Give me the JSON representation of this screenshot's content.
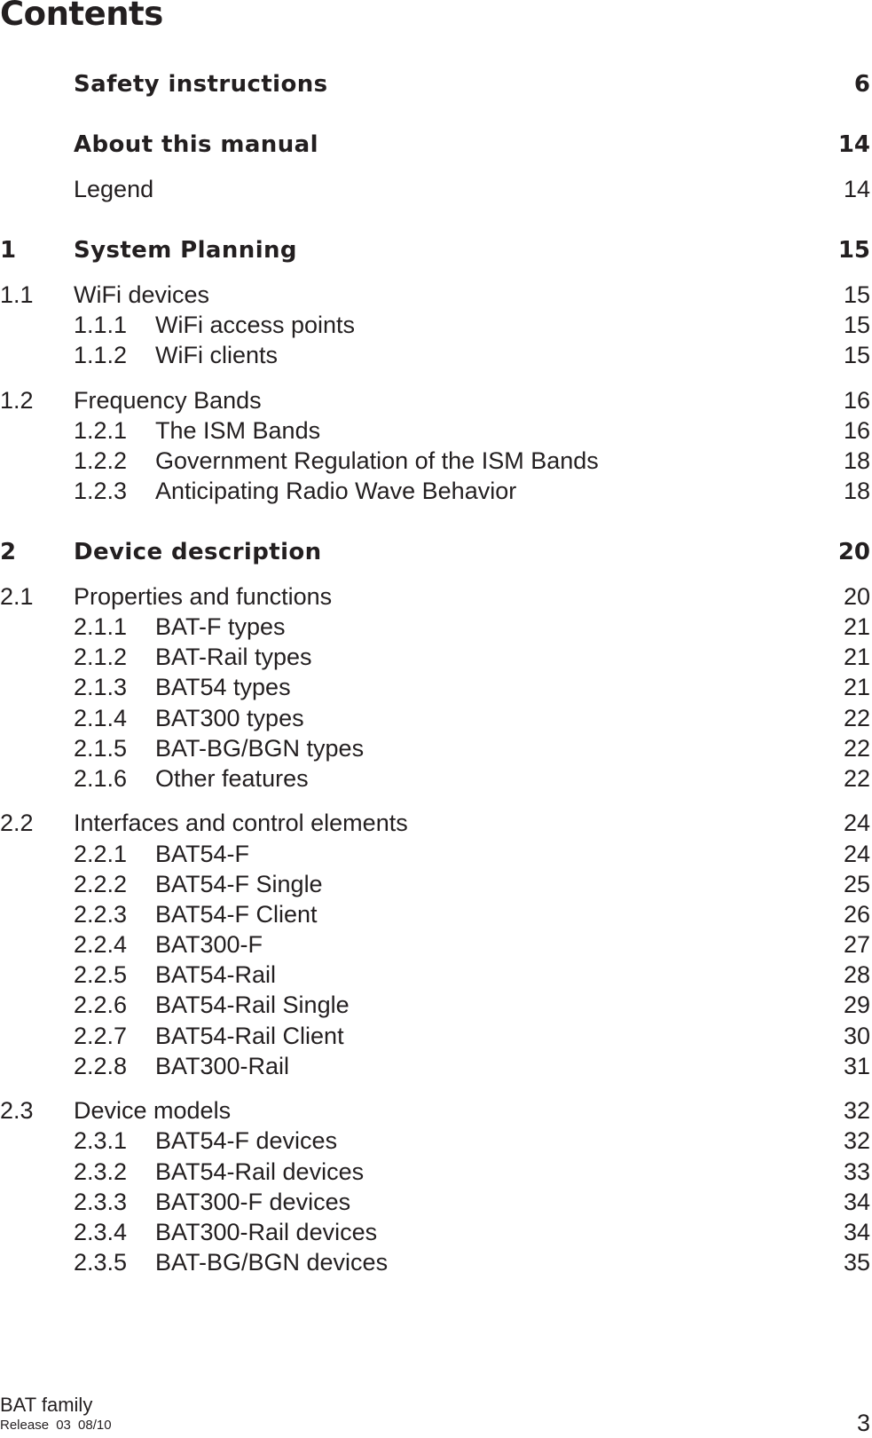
{
  "page_title": "Contents",
  "toc": [
    {
      "number": "",
      "title": "Safety instructions",
      "page": "6",
      "level": 0,
      "bold": true
    },
    {
      "number": "",
      "title": "About this manual",
      "page": "14",
      "level": 0,
      "bold": true
    },
    {
      "number": "",
      "title": "Legend",
      "page": "14",
      "level": 0,
      "bold": false
    },
    {
      "number": "1",
      "title": "System Planning",
      "page": "15",
      "level": 1,
      "bold": true
    },
    {
      "number": "1.1",
      "title": "WiFi devices",
      "page": "15",
      "level": 2,
      "bold": false
    },
    {
      "number": "1.1.1",
      "title": "WiFi access points",
      "page": "15",
      "level": 3,
      "bold": false
    },
    {
      "number": "1.1.2",
      "title": "WiFi clients",
      "page": "15",
      "level": 3,
      "bold": false
    },
    {
      "number": "1.2",
      "title": "Frequency Bands",
      "page": "16",
      "level": 2,
      "bold": false
    },
    {
      "number": "1.2.1",
      "title": "The ISM Bands",
      "page": "16",
      "level": 3,
      "bold": false
    },
    {
      "number": "1.2.2",
      "title": "Government Regulation of the ISM Bands",
      "page": "18",
      "level": 3,
      "bold": false
    },
    {
      "number": "1.2.3",
      "title": "Anticipating Radio Wave Behavior",
      "page": "18",
      "level": 3,
      "bold": false
    },
    {
      "number": "2",
      "title": "Device description",
      "page": "20",
      "level": 1,
      "bold": true
    },
    {
      "number": "2.1",
      "title": "Properties and functions",
      "page": "20",
      "level": 2,
      "bold": false
    },
    {
      "number": "2.1.1",
      "title": "BAT-F types",
      "page": "21",
      "level": 3,
      "bold": false
    },
    {
      "number": "2.1.2",
      "title": "BAT-Rail types",
      "page": "21",
      "level": 3,
      "bold": false
    },
    {
      "number": "2.1.3",
      "title": "BAT54 types",
      "page": "21",
      "level": 3,
      "bold": false
    },
    {
      "number": "2.1.4",
      "title": "BAT300 types",
      "page": "22",
      "level": 3,
      "bold": false
    },
    {
      "number": "2.1.5",
      "title": "BAT-BG/BGN types",
      "page": "22",
      "level": 3,
      "bold": false
    },
    {
      "number": "2.1.6",
      "title": "Other features",
      "page": "22",
      "level": 3,
      "bold": false
    },
    {
      "number": "2.2",
      "title": "Interfaces and control elements",
      "page": "24",
      "level": 2,
      "bold": false
    },
    {
      "number": "2.2.1",
      "title": "BAT54-F",
      "page": "24",
      "level": 3,
      "bold": false
    },
    {
      "number": "2.2.2",
      "title": "BAT54-F Single",
      "page": "25",
      "level": 3,
      "bold": false
    },
    {
      "number": "2.2.3",
      "title": "BAT54-F Client",
      "page": "26",
      "level": 3,
      "bold": false
    },
    {
      "number": "2.2.4",
      "title": "BAT300-F",
      "page": "27",
      "level": 3,
      "bold": false
    },
    {
      "number": "2.2.5",
      "title": "BAT54-Rail",
      "page": "28",
      "level": 3,
      "bold": false
    },
    {
      "number": "2.2.6",
      "title": "BAT54-Rail Single",
      "page": "29",
      "level": 3,
      "bold": false
    },
    {
      "number": "2.2.7",
      "title": "BAT54-Rail Client",
      "page": "30",
      "level": 3,
      "bold": false
    },
    {
      "number": "2.2.8",
      "title": "BAT300-Rail",
      "page": "31",
      "level": 3,
      "bold": false
    },
    {
      "number": "2.3",
      "title": "Device models",
      "page": "32",
      "level": 2,
      "bold": false
    },
    {
      "number": "2.3.1",
      "title": "BAT54-F devices",
      "page": "32",
      "level": 3,
      "bold": false
    },
    {
      "number": "2.3.2",
      "title": "BAT54-Rail devices",
      "page": "33",
      "level": 3,
      "bold": false
    },
    {
      "number": "2.3.3",
      "title": "BAT300-F devices",
      "page": "34",
      "level": 3,
      "bold": false
    },
    {
      "number": "2.3.4",
      "title": "BAT300-Rail devices",
      "page": "34",
      "level": 3,
      "bold": false
    },
    {
      "number": "2.3.5",
      "title": "BAT-BG/BGN devices",
      "page": "35",
      "level": 3,
      "bold": false
    }
  ],
  "footer": {
    "product": "BAT family",
    "release": "Release  03  08/10",
    "page_number": "3"
  }
}
